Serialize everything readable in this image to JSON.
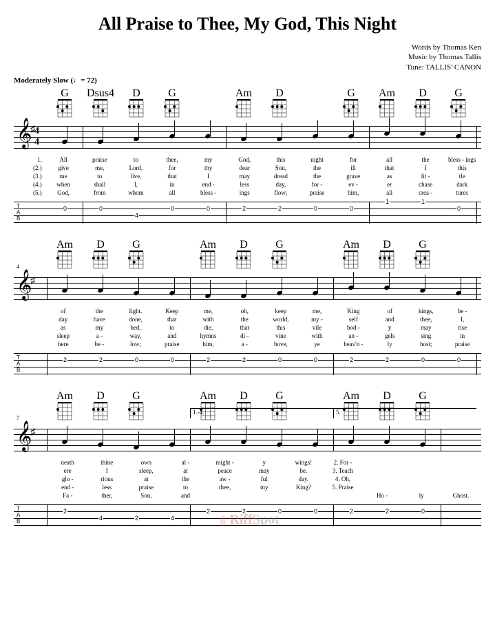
{
  "title": "All Praise to Thee, My God, This Night",
  "credits": {
    "words": "Words by Thomas Ken",
    "music": "Music by Thomas Tallis",
    "tune": "Tune: TALLIS' CANON"
  },
  "tempo": "Moderately Slow  (♩= 72)",
  "watermark": {
    "brand1": "Riff",
    "brand2": "Spot"
  },
  "systems": [
    {
      "measure_start": 1,
      "chords": [
        {
          "name": "G",
          "pos": 0
        },
        {
          "name": "Dsus4",
          "pos": 1
        },
        {
          "name": "D",
          "pos": 2
        },
        {
          "name": "G",
          "pos": 3
        },
        {
          "name": "",
          "pos": 4
        },
        {
          "name": "Am",
          "pos": 5
        },
        {
          "name": "D",
          "pos": 6
        },
        {
          "name": "",
          "pos": 7
        },
        {
          "name": "G",
          "pos": 8
        },
        {
          "name": "Am",
          "pos": 9
        },
        {
          "name": "D",
          "pos": 10
        },
        {
          "name": "G",
          "pos": 11
        }
      ],
      "barlines": [
        1,
        5,
        9,
        12
      ],
      "notes": [
        {
          "pos": 0,
          "y": 30
        },
        {
          "pos": 1,
          "y": 30
        },
        {
          "pos": 2,
          "y": 26
        },
        {
          "pos": 3,
          "y": 22
        },
        {
          "pos": 4,
          "y": 22
        },
        {
          "pos": 5,
          "y": 26
        },
        {
          "pos": 6,
          "y": 26
        },
        {
          "pos": 7,
          "y": 22
        },
        {
          "pos": 8,
          "y": 22
        },
        {
          "pos": 9,
          "y": 18
        },
        {
          "pos": 10,
          "y": 18
        },
        {
          "pos": 11,
          "y": 22
        }
      ],
      "lyrics": [
        {
          "vn": "1.",
          "syll": [
            "All",
            "praise",
            "to",
            "thee,",
            "my",
            "God,",
            "this",
            "night",
            "for",
            "all",
            "the",
            "bless - ings"
          ]
        },
        {
          "vn": "(2.)",
          "syll": [
            "give",
            "me,",
            "Lord,",
            "for",
            "thy",
            "dear",
            "Son,",
            "the",
            "ill",
            "that",
            "I",
            "this"
          ]
        },
        {
          "vn": "(3.)",
          "syll": [
            "me",
            "to",
            "live,",
            "that",
            "I",
            "may",
            "dread",
            "the",
            "grave",
            "as",
            "lit -",
            "tle"
          ]
        },
        {
          "vn": "(4.)",
          "syll": [
            "when",
            "shall",
            "I,",
            "in",
            "end -",
            "less",
            "day,",
            "for -",
            "ev -",
            "er",
            "chase",
            "dark"
          ]
        },
        {
          "vn": "(5.)",
          "syll": [
            "God,",
            "from",
            "whom",
            "all",
            "bless -",
            "ings",
            "flow;",
            "praise",
            "him,",
            "all",
            "crea -",
            "tures"
          ]
        }
      ],
      "tab": [
        {
          "pos": 0,
          "str": 2,
          "fret": "0"
        },
        {
          "pos": 1,
          "str": 2,
          "fret": "0"
        },
        {
          "pos": 2,
          "str": 3,
          "fret": "4"
        },
        {
          "pos": 3,
          "str": 2,
          "fret": "0"
        },
        {
          "pos": 4,
          "str": 2,
          "fret": "0"
        },
        {
          "pos": 5,
          "str": 2,
          "fret": "2"
        },
        {
          "pos": 6,
          "str": 2,
          "fret": "2"
        },
        {
          "pos": 7,
          "str": 2,
          "fret": "0"
        },
        {
          "pos": 8,
          "str": 2,
          "fret": "0"
        },
        {
          "pos": 9,
          "str": 1,
          "fret": "1"
        },
        {
          "pos": 10,
          "str": 1,
          "fret": "1"
        },
        {
          "pos": 11,
          "str": 2,
          "fret": "0"
        }
      ]
    },
    {
      "measure_start": 4,
      "chords": [
        {
          "name": "Am",
          "pos": 0
        },
        {
          "name": "D",
          "pos": 1
        },
        {
          "name": "G",
          "pos": 2
        },
        {
          "name": "",
          "pos": 3
        },
        {
          "name": "Am",
          "pos": 4
        },
        {
          "name": "D",
          "pos": 5
        },
        {
          "name": "G",
          "pos": 6
        },
        {
          "name": "",
          "pos": 7
        },
        {
          "name": "Am",
          "pos": 8
        },
        {
          "name": "D",
          "pos": 9
        },
        {
          "name": "G",
          "pos": 10
        },
        {
          "name": "",
          "pos": 11
        }
      ],
      "barlines": [
        0,
        4,
        8,
        12
      ],
      "notes": [
        {
          "pos": 0,
          "y": 26
        },
        {
          "pos": 1,
          "y": 26
        },
        {
          "pos": 2,
          "y": 30
        },
        {
          "pos": 3,
          "y": 30
        },
        {
          "pos": 4,
          "y": 34
        },
        {
          "pos": 5,
          "y": 34
        },
        {
          "pos": 6,
          "y": 30
        },
        {
          "pos": 7,
          "y": 30
        },
        {
          "pos": 8,
          "y": 22
        },
        {
          "pos": 9,
          "y": 22
        },
        {
          "pos": 10,
          "y": 26
        },
        {
          "pos": 11,
          "y": 30
        }
      ],
      "lyrics": [
        {
          "vn": "",
          "syll": [
            "of",
            "the",
            "light.",
            "Keep",
            "me,",
            "oh,",
            "keep",
            "me,",
            "King",
            "of",
            "kings,",
            "be -"
          ]
        },
        {
          "vn": "",
          "syll": [
            "day",
            "have",
            "done,",
            "that",
            "with",
            "the",
            "world,",
            "my -",
            "self",
            "and",
            "thee,",
            "I,"
          ]
        },
        {
          "vn": "",
          "syll": [
            "as",
            "my",
            "bed,",
            "to",
            "die,",
            "that",
            "this",
            "vile",
            "bod -",
            "y",
            "may",
            "rise"
          ]
        },
        {
          "vn": "",
          "syll": [
            "sleep",
            "a -",
            "way,",
            "and",
            "hymns",
            "di -",
            "vine",
            "with",
            "an -",
            "gels",
            "sing",
            "in"
          ]
        },
        {
          "vn": "",
          "syll": [
            "here",
            "be -",
            "low;",
            "praise",
            "him,",
            "a -",
            "bove,",
            "ye",
            "heav'n -",
            "ly",
            "host;",
            "praise"
          ]
        }
      ],
      "tab": [
        {
          "pos": 0,
          "str": 2,
          "fret": "2"
        },
        {
          "pos": 1,
          "str": 2,
          "fret": "2"
        },
        {
          "pos": 2,
          "str": 2,
          "fret": "0"
        },
        {
          "pos": 3,
          "str": 2,
          "fret": "0"
        },
        {
          "pos": 4,
          "str": 2,
          "fret": "2"
        },
        {
          "pos": 5,
          "str": 2,
          "fret": "2"
        },
        {
          "pos": 6,
          "str": 2,
          "fret": "0"
        },
        {
          "pos": 7,
          "str": 2,
          "fret": "0"
        },
        {
          "pos": 8,
          "str": 2,
          "fret": "2"
        },
        {
          "pos": 9,
          "str": 2,
          "fret": "2"
        },
        {
          "pos": 10,
          "str": 2,
          "fret": "0"
        },
        {
          "pos": 11,
          "str": 2,
          "fret": "0"
        }
      ]
    },
    {
      "measure_start": 7,
      "volta": [
        {
          "label": "1.-4.",
          "start": 4,
          "end": 8
        },
        {
          "label": "5.",
          "start": 8,
          "end": 12
        }
      ],
      "chords": [
        {
          "name": "Am",
          "pos": 0
        },
        {
          "name": "D",
          "pos": 1
        },
        {
          "name": "G",
          "pos": 2
        },
        {
          "name": "",
          "pos": 3
        },
        {
          "name": "Am",
          "pos": 4
        },
        {
          "name": "D",
          "pos": 5
        },
        {
          "name": "G",
          "pos": 6
        },
        {
          "name": "",
          "pos": 7
        },
        {
          "name": "Am",
          "pos": 8
        },
        {
          "name": "D",
          "pos": 9
        },
        {
          "name": "G",
          "pos": 10
        }
      ],
      "barlines": [
        0,
        4,
        8,
        11
      ],
      "notes": [
        {
          "pos": 0,
          "y": 26
        },
        {
          "pos": 1,
          "y": 30
        },
        {
          "pos": 2,
          "y": 34
        },
        {
          "pos": 3,
          "y": 30
        },
        {
          "pos": 4,
          "y": 26
        },
        {
          "pos": 5,
          "y": 26
        },
        {
          "pos": 6,
          "y": 30
        },
        {
          "pos": 7,
          "y": 30
        },
        {
          "pos": 8,
          "y": 26
        },
        {
          "pos": 9,
          "y": 26
        },
        {
          "pos": 10,
          "y": 30
        }
      ],
      "lyrics": [
        {
          "vn": "",
          "syll": [
            "neath",
            "thine",
            "own",
            "al -",
            "might -",
            "y",
            "wings!",
            "2. For -",
            "",
            "",
            ""
          ]
        },
        {
          "vn": "",
          "syll": [
            "ere",
            "I",
            "sleep,",
            "at",
            "peace",
            "may",
            "be.",
            "3. Teach",
            "",
            "",
            ""
          ]
        },
        {
          "vn": "",
          "syll": [
            "glo -",
            "rious",
            "at",
            "the",
            "aw -",
            "ful",
            "day.",
            "4. Oh,",
            "",
            "",
            ""
          ]
        },
        {
          "vn": "",
          "syll": [
            "end -",
            "less",
            "praise",
            "to",
            "thee,",
            "my",
            "King?",
            "5. Praise",
            "",
            "",
            ""
          ]
        },
        {
          "vn": "",
          "syll": [
            "Fa -",
            "ther,",
            "Son,",
            "and",
            "",
            "",
            "",
            "",
            "Ho -",
            "ly",
            "Ghost."
          ]
        }
      ],
      "tab": [
        {
          "pos": 0,
          "str": 2,
          "fret": "2"
        },
        {
          "pos": 1,
          "str": 3,
          "fret": "4"
        },
        {
          "pos": 2,
          "str": 3,
          "fret": "2"
        },
        {
          "pos": 3,
          "str": 3,
          "fret": "4"
        },
        {
          "pos": 4,
          "str": 2,
          "fret": "2"
        },
        {
          "pos": 5,
          "str": 2,
          "fret": "2"
        },
        {
          "pos": 6,
          "str": 2,
          "fret": "0"
        },
        {
          "pos": 7,
          "str": 2,
          "fret": "0"
        },
        {
          "pos": 8,
          "str": 2,
          "fret": "2"
        },
        {
          "pos": 9,
          "str": 2,
          "fret": "2"
        },
        {
          "pos": 10,
          "str": 2,
          "fret": "0"
        }
      ]
    }
  ]
}
